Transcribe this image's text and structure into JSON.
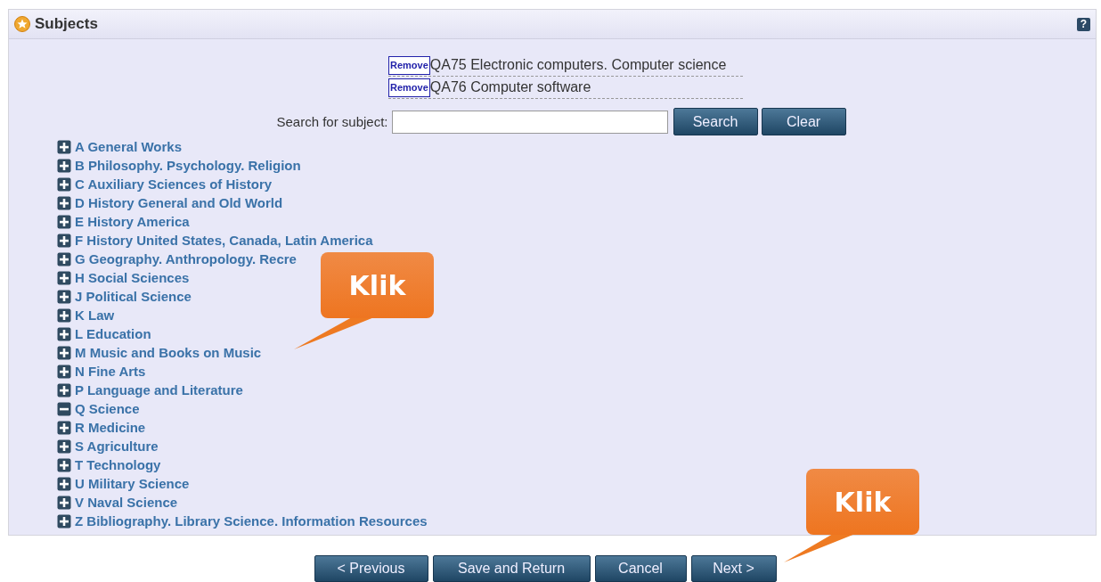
{
  "panel": {
    "title": "Subjects",
    "help": "?"
  },
  "selected_subjects": [
    {
      "action": "Remove",
      "label": "QA75 Electronic computers. Computer science"
    },
    {
      "action": "Remove",
      "label": "QA76 Computer software"
    }
  ],
  "search": {
    "label": "Search for subject:",
    "buttons": [
      "Search",
      "Clear"
    ]
  },
  "tree": [
    {
      "label": "A General Works",
      "expanded": false
    },
    {
      "label": "B Philosophy. Psychology. Religion",
      "expanded": false
    },
    {
      "label": "C Auxiliary Sciences of History",
      "expanded": false
    },
    {
      "label": "D History General and Old World",
      "expanded": false
    },
    {
      "label": "E History America",
      "expanded": false
    },
    {
      "label": "F History United States, Canada, Latin America",
      "expanded": false
    },
    {
      "label": "G Geography. Anthropology. Recre",
      "expanded": false
    },
    {
      "label": "H Social Sciences",
      "expanded": false
    },
    {
      "label": "J Political Science",
      "expanded": false
    },
    {
      "label": "K Law",
      "expanded": false
    },
    {
      "label": "L Education",
      "expanded": false
    },
    {
      "label": "M Music and Books on Music",
      "expanded": false
    },
    {
      "label": "N Fine Arts",
      "expanded": false
    },
    {
      "label": "P Language and Literature",
      "expanded": false
    },
    {
      "label": "Q Science",
      "expanded": true
    },
    {
      "label": "R Medicine",
      "expanded": false
    },
    {
      "label": "S Agriculture",
      "expanded": false
    },
    {
      "label": "T Technology",
      "expanded": false
    },
    {
      "label": "U Military Science",
      "expanded": false
    },
    {
      "label": "V Naval Science",
      "expanded": false
    },
    {
      "label": "Z Bibliography. Library Science. Information Resources",
      "expanded": false
    }
  ],
  "nav_buttons": [
    "< Previous",
    "Save and Return",
    "Cancel",
    "Next >"
  ],
  "callouts": [
    {
      "text": "Klik"
    },
    {
      "text": "Klik"
    }
  ]
}
